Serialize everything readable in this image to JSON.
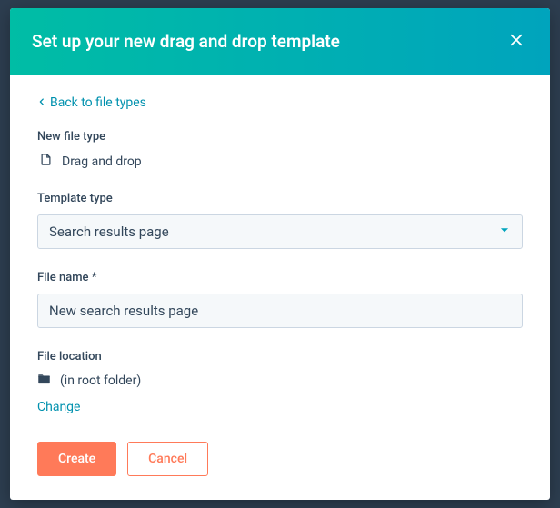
{
  "header": {
    "title": "Set up your new drag and drop template"
  },
  "back": {
    "label": "Back to file types"
  },
  "fileType": {
    "label": "New file type",
    "value": "Drag and drop"
  },
  "templateType": {
    "label": "Template type",
    "selected": "Search results page"
  },
  "fileName": {
    "label": "File name *",
    "value": "New search results page"
  },
  "fileLocation": {
    "label": "File location",
    "value": "(in root folder)",
    "changeLabel": "Change"
  },
  "actions": {
    "create": "Create",
    "cancel": "Cancel"
  }
}
